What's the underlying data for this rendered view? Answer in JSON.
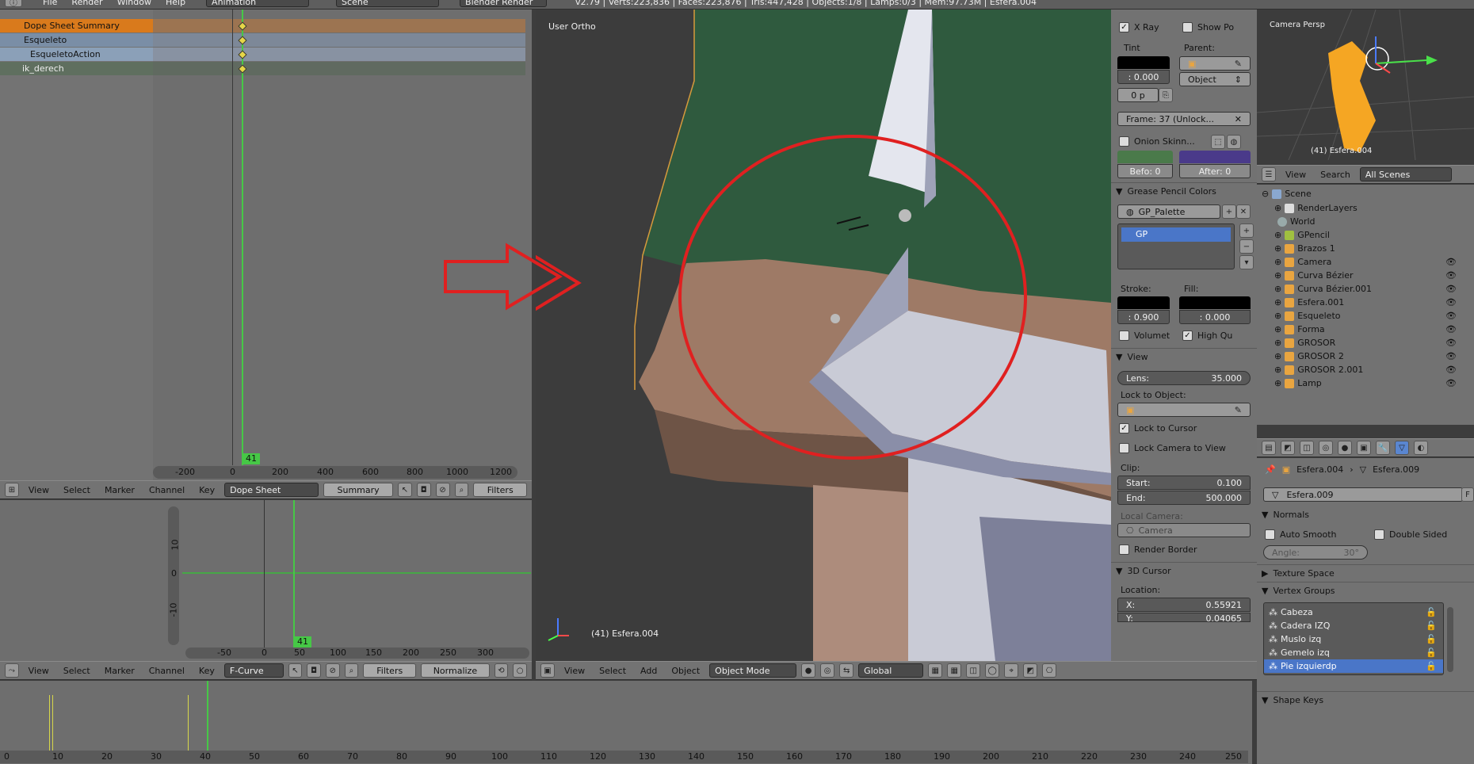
{
  "topbar": {
    "menus": [
      "File",
      "Render",
      "Window",
      "Help"
    ],
    "screen": "Animation",
    "scene": "Scene",
    "engine": "Blender Render",
    "stats": "v2.79 | Verts:223,836 | Faces:223,876 | Tris:447,428 | Objects:1/8 | Lamps:0/3 | Mem:97.73M | Esfera.004"
  },
  "dopesheet": {
    "channels": [
      "Dope Sheet Summary",
      "Esqueleto",
      "EsqueletoAction",
      "ik_derech"
    ],
    "ruler": [
      "-200",
      "0",
      "200",
      "400",
      "600",
      "800",
      "1000",
      "1200"
    ],
    "current_frame": "41",
    "header": {
      "menus": [
        "View",
        "Select",
        "Marker",
        "Channel",
        "Key"
      ],
      "mode": "Dope Sheet",
      "summary": "Summary",
      "filters": "Filters"
    }
  },
  "graph": {
    "y_ticks": [
      "10",
      "0",
      "-10"
    ],
    "x_ticks": [
      "-50",
      "0",
      "50",
      "100",
      "150",
      "200",
      "250",
      "300"
    ],
    "current_frame": "41",
    "header": {
      "menus": [
        "View",
        "Select",
        "Marker",
        "Channel",
        "Key"
      ],
      "mode": "F-Curve",
      "filters": "Filters",
      "normalize": "Normalize"
    }
  },
  "timeline": {
    "ticks": [
      "0",
      "10",
      "20",
      "30",
      "40",
      "50",
      "60",
      "70",
      "80",
      "90",
      "100",
      "110",
      "120",
      "130",
      "140",
      "150",
      "160",
      "170",
      "180",
      "190",
      "200",
      "210",
      "220",
      "230",
      "240",
      "250"
    ]
  },
  "viewport": {
    "label": "User Ortho",
    "object_label": "(41) Esfera.004",
    "header": {
      "menus": [
        "View",
        "Select",
        "Add",
        "Object"
      ],
      "mode": "Object Mode",
      "orientation": "Global"
    },
    "colors": {
      "bg": "#3c3c3c",
      "cloth": "#2f5a3e",
      "skin": "#9e7a66",
      "bone": "#c9cbd6",
      "circle": "#e02020",
      "arrow": "#e02020"
    }
  },
  "properties": {
    "xray": "X Ray",
    "show_po": "Show Po",
    "tint": "Tint",
    "parent": "Parent:",
    "tint_value": ": 0.000",
    "parent_type": "Object",
    "zero_p": "0 p",
    "frame_lock": "Frame: 37 (Unlock...",
    "onion": "Onion Skinn...",
    "before": "Befo: 0",
    "after": "After: 0",
    "gp_colors_title": "Grease Pencil Colors",
    "palette": "GP_Palette",
    "gp_layer": "GP",
    "stroke": "Stroke:",
    "fill": "Fill:",
    "stroke_val": ": 0.900",
    "fill_val": ": 0.000",
    "volumet": "Volumet",
    "high_qu": "High Qu",
    "view_title": "View",
    "lens_label": "Lens:",
    "lens_val": "35.000",
    "lock_object": "Lock to Object:",
    "lock_cursor": "Lock to Cursor",
    "lock_camera": "Lock Camera to View",
    "clip": "Clip:",
    "start_label": "Start:",
    "start_val": "0.100",
    "end_label": "End:",
    "end_val": "500.000",
    "local_camera": "Local Camera:",
    "camera": "Camera",
    "render_border": "Render Border",
    "cursor_title": "3D Cursor",
    "location": "Location:",
    "x_label": "X:",
    "x_val": "0.55921",
    "y_label": "Y:",
    "y_val": "0.04065"
  },
  "camera_view": {
    "label": "Camera Persp",
    "object_label": "(41) Esfera.004"
  },
  "outliner": {
    "header": {
      "view": "View",
      "search": "Search",
      "scope": "All Scenes"
    },
    "items": [
      "Scene",
      "RenderLayers",
      "World",
      "GPencil",
      "Brazos 1",
      "Camera",
      "Curva Bézier",
      "Curva Bézier.001",
      "Esfera.001",
      "Esqueleto",
      "Forma",
      "GROSOR",
      "GROSOR 2",
      "GROSOR 2.001",
      "Lamp"
    ]
  },
  "data_props": {
    "breadcrumb_obj": "Esfera.004",
    "breadcrumb_mesh": "Esfera.009",
    "mesh_name": "Esfera.009",
    "f_label": "F",
    "normals": "Normals",
    "auto_smooth": "Auto Smooth",
    "double_sided": "Double Sided",
    "angle_label": "Angle:",
    "angle_val": "30°",
    "texture_space": "Texture Space",
    "vertex_groups": "Vertex Groups",
    "groups": [
      "Cabeza",
      "Cadera IZQ",
      "Muslo izq",
      "Gemelo izq",
      "Pie izquierdp"
    ],
    "shape_keys": "Shape Keys"
  }
}
